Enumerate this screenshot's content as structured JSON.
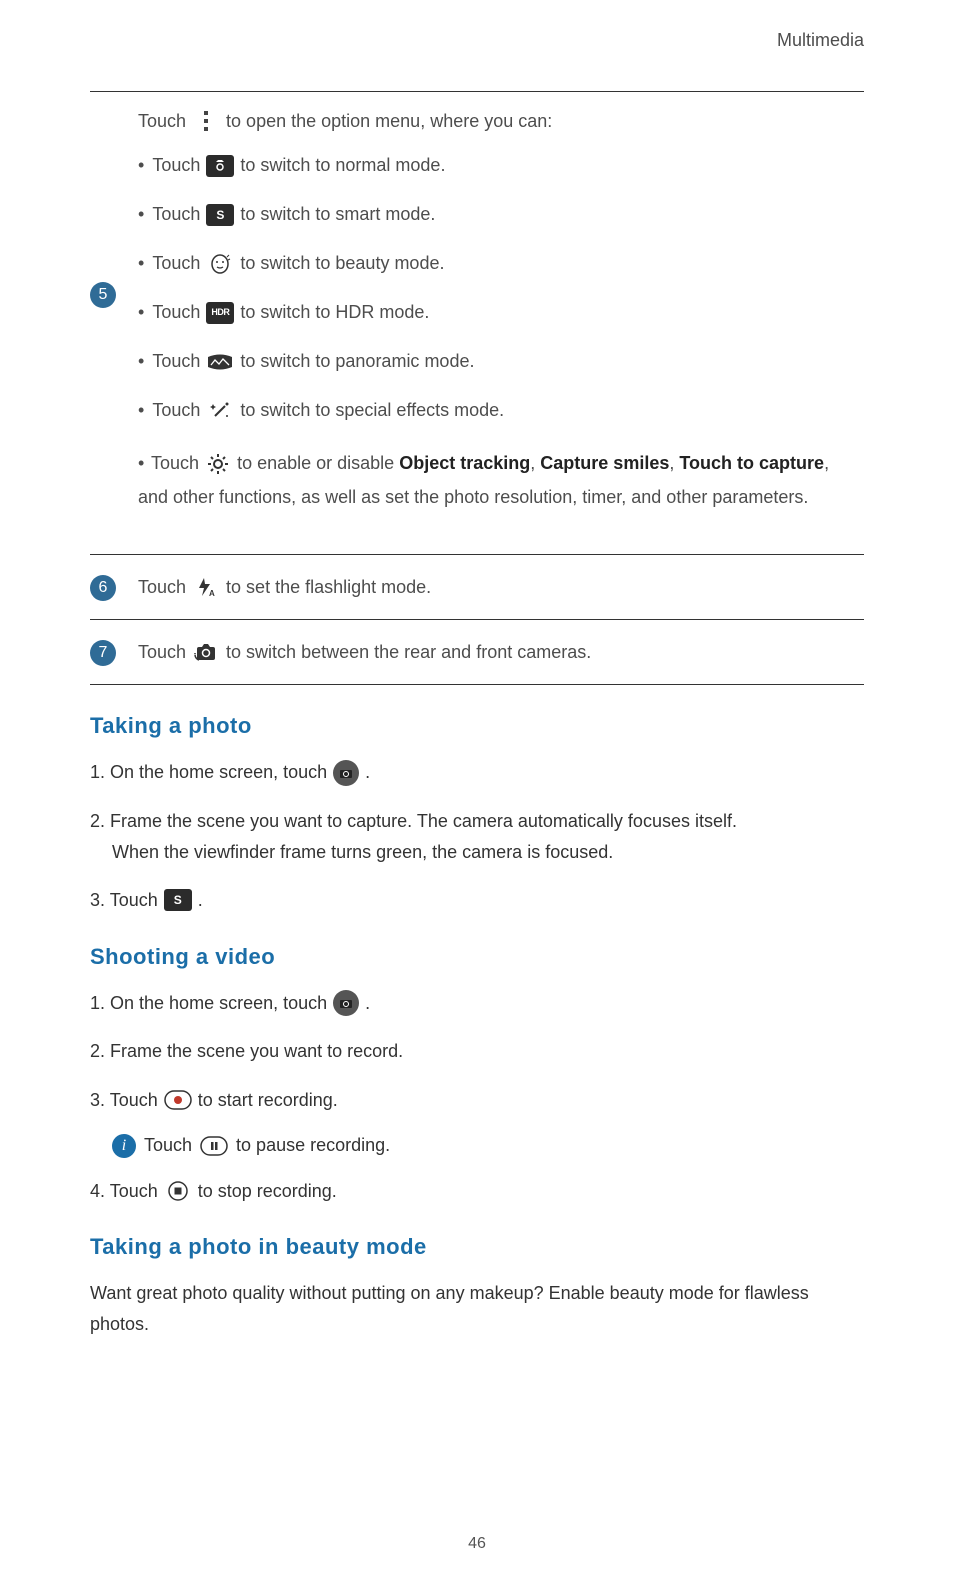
{
  "header": "Multimedia",
  "s5": {
    "num": "5",
    "intro_a": "Touch",
    "intro_b": "to open the option menu, where you can:",
    "b1a": "Touch",
    "b1b": "to switch to normal mode.",
    "b2a": "Touch",
    "b2b": "to switch to smart mode.",
    "b3a": "Touch",
    "b3b": "to switch to beauty mode.",
    "b4a": "Touch",
    "b4b": "to switch to HDR mode.",
    "b5a": "Touch",
    "b5b": "to switch to panoramic mode.",
    "b6a": "Touch",
    "b6b": "to switch to special effects mode.",
    "b7a": "Touch",
    "b7b": "to enable or disable",
    "b7_bold1": "Object tracking",
    "b7_comma": ",",
    "b7_bold2": "Capture smiles",
    "b7_comma2": ",",
    "b7_bold3": "Touch to capture",
    "b7c": ", and other functions, as well as set the photo resolution, timer, and other parameters."
  },
  "s6": {
    "num": "6",
    "a": "Touch",
    "b": "to set the flashlight mode."
  },
  "s7": {
    "num": "7",
    "a": "Touch",
    "b": "to switch between the rear and front cameras."
  },
  "photo": {
    "heading": "Taking  a  photo",
    "step1a": "1. On the home screen, touch",
    "step1b": ".",
    "step2": "2. Frame the scene you want to capture. The camera automatically focuses itself.",
    "step2b": "When the viewfinder frame turns green, the camera is focused.",
    "step3a": "3. Touch",
    "step3b": "."
  },
  "video": {
    "heading": "Shooting  a  video",
    "step1a": "1. On the home screen, touch",
    "step1b": ".",
    "step2": "2. Frame the scene you want to record.",
    "step3a": "3. Touch",
    "step3b": "to start recording.",
    "tipa": "Touch",
    "tipb": "to pause recording.",
    "step4a": "4. Touch",
    "step4b": "to stop recording."
  },
  "beauty": {
    "heading": "Taking  a  photo  in  beauty  mode",
    "body": "Want great photo quality without putting on any makeup? Enable beauty mode for flawless photos."
  },
  "pagenum": "46"
}
